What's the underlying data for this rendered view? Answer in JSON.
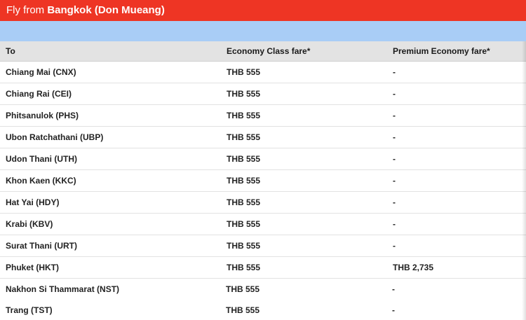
{
  "banner": {
    "prefix": "Fly from",
    "origin": "Bangkok (Don Mueang)"
  },
  "colors": {
    "banner_red": "#ee3524",
    "strip_blue": "#a9cdf6",
    "header_gray": "#e3e3e3"
  },
  "table": {
    "headers": {
      "to": "To",
      "economy": "Economy Class fare*",
      "premium": "Premium Economy fare*"
    },
    "rows": [
      {
        "to": "Chiang Mai (CNX)",
        "economy": "THB 555",
        "premium": "-"
      },
      {
        "to": "Chiang Rai (CEI)",
        "economy": "THB 555",
        "premium": "-"
      },
      {
        "to": "Phitsanulok (PHS)",
        "economy": "THB 555",
        "premium": "-"
      },
      {
        "to": "Ubon Ratchathani (UBP)",
        "economy": "THB 555",
        "premium": "-"
      },
      {
        "to": "Udon Thani (UTH)",
        "economy": "THB 555",
        "premium": "-"
      },
      {
        "to": "Khon Kaen (KKC)",
        "economy": "THB 555",
        "premium": "-"
      },
      {
        "to": "Hat Yai (HDY)",
        "economy": "THB 555",
        "premium": "-"
      },
      {
        "to": "Krabi (KBV)",
        "economy": "THB 555",
        "premium": "-"
      },
      {
        "to": "Surat Thani (URT)",
        "economy": "THB 555",
        "premium": "-"
      },
      {
        "to": "Phuket (HKT)",
        "economy": "THB 555",
        "premium": "THB 2,735"
      },
      {
        "to": "Nakhon Si Thammarat (NST)",
        "economy": "THB 555",
        "premium": "-"
      },
      {
        "to": "Trang (TST)",
        "economy": "THB 555",
        "premium": "-"
      }
    ]
  }
}
